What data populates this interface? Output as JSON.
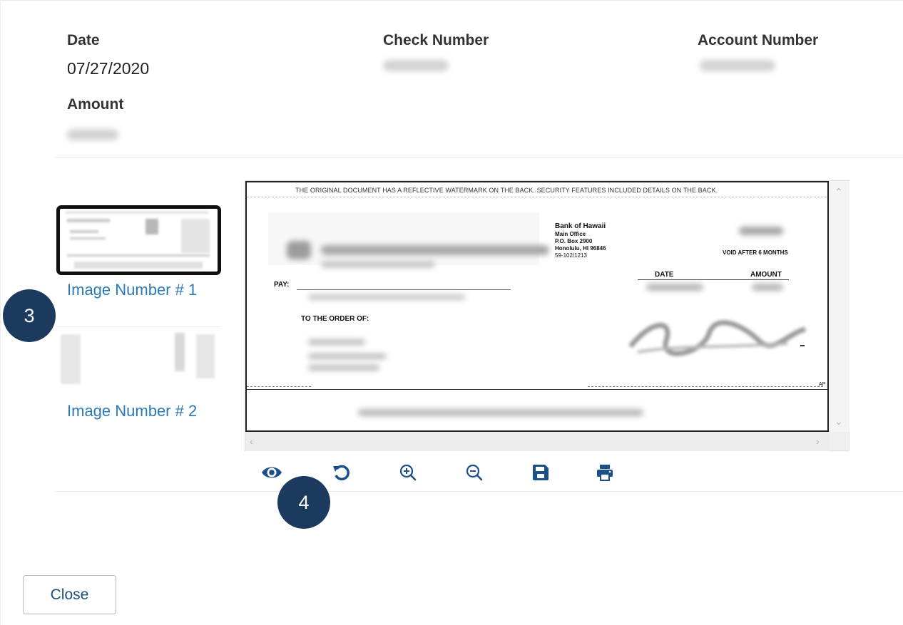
{
  "details": {
    "date_label": "Date",
    "date_value": "07/27/2020",
    "check_number_label": "Check Number",
    "account_number_label": "Account Number",
    "amount_label": "Amount"
  },
  "thumbnails": [
    {
      "label": "Image Number # 1",
      "selected": true
    },
    {
      "label": "Image Number # 2",
      "selected": false
    }
  ],
  "check_image": {
    "watermark_text": "THE ORIGINAL DOCUMENT HAS A REFLECTIVE WATERMARK ON THE BACK. SECURITY FEATURES INCLUDED DETAILS ON THE BACK.",
    "bank_name": "Bank of Hawaii",
    "bank_line_1": "Main Office",
    "bank_line_2": "P.O. Box 2900",
    "bank_line_3": "Honolulu, HI 96846",
    "bank_line_4": "59-102/1213",
    "void_text": "VOID AFTER 6 MONTHS",
    "date_label": "DATE",
    "amount_label": "AMOUNT",
    "pay_label": "PAY:",
    "order_label": "TO THE ORDER OF:",
    "corner_text": "AP"
  },
  "toolbar": {
    "tools": [
      "eye-icon",
      "rotate-icon",
      "zoom-in-icon",
      "zoom-out-icon",
      "save-icon",
      "print-icon"
    ],
    "accent_color": "#1b4f8a"
  },
  "badges": [
    "3",
    "4"
  ],
  "footer": {
    "close_label": "Close"
  }
}
